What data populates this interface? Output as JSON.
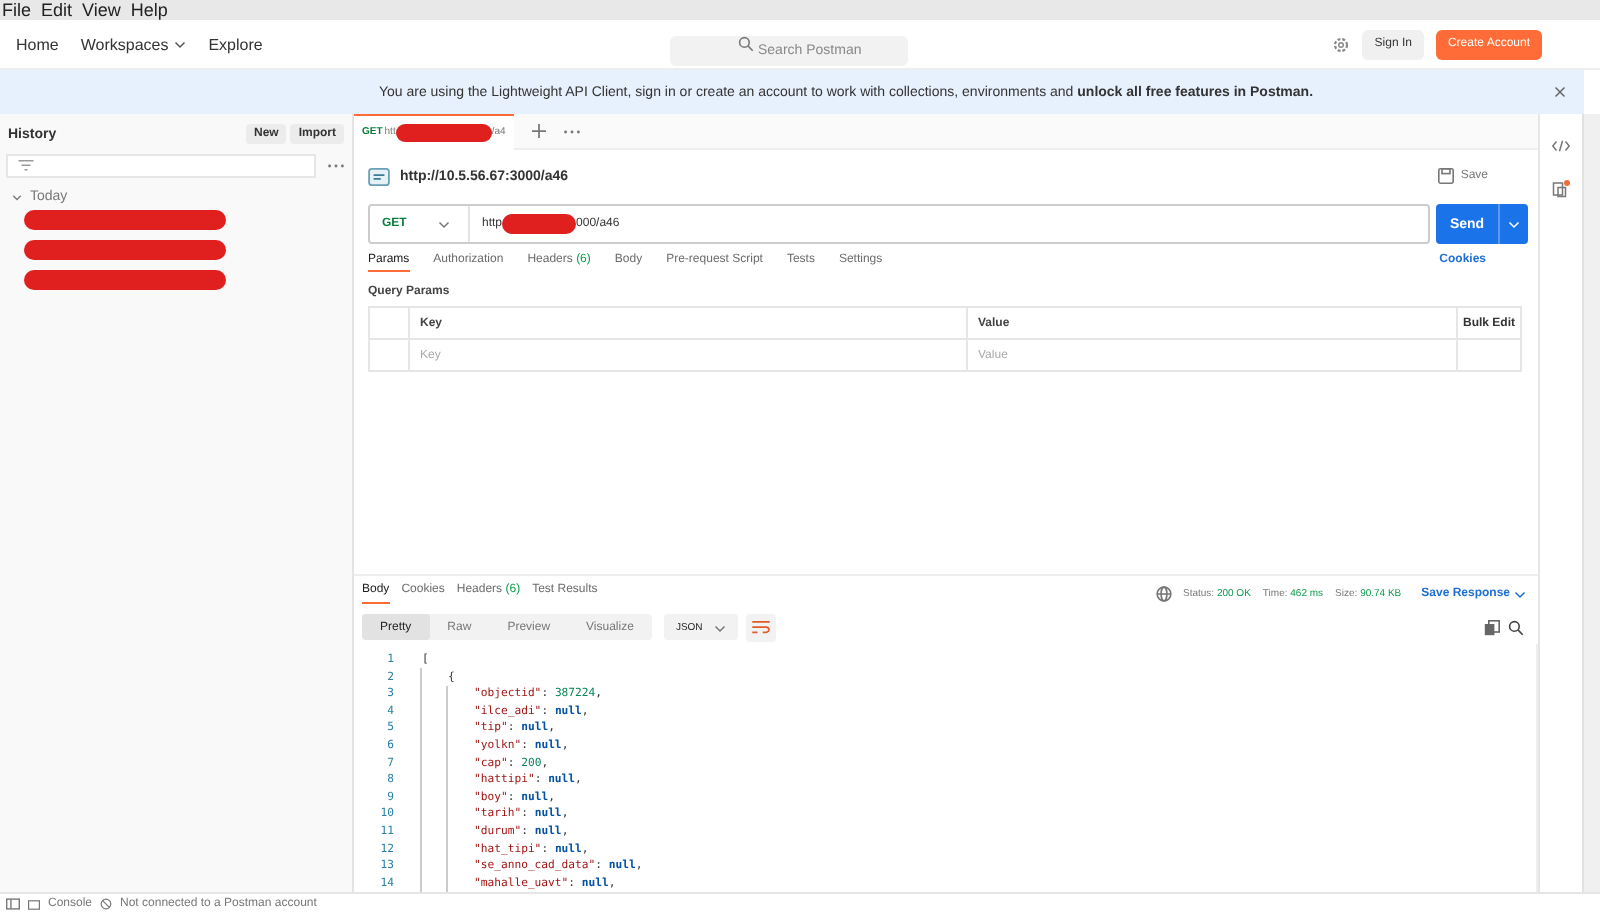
{
  "menu_bar": [
    "File",
    "Edit",
    "View",
    "Help"
  ],
  "header": {
    "nav": [
      {
        "label": "Home",
        "dropdown": false
      },
      {
        "label": "Workspaces",
        "dropdown": true
      },
      {
        "label": "Explore",
        "dropdown": false
      }
    ],
    "search": {
      "placeholder": "Search Postman"
    },
    "buttons": [
      {
        "label": "Sign In",
        "kind": "secondary"
      },
      {
        "label": "Create Account",
        "kind": "primary"
      }
    ]
  },
  "banner": {
    "text": "You are using the Lightweight API Client, sign in or create an account to work with collections, environments and **unlock all free features in Postman.**"
  },
  "sidebar": {
    "title": "History",
    "buttons": [
      "New",
      "Import"
    ],
    "groups": [
      {
        "label": "Today",
        "expanded": true,
        "items": [
          {
            "kind": "redacted"
          },
          {
            "kind": "redacted"
          },
          {
            "kind": "redacted"
          }
        ]
      }
    ]
  },
  "request_tabs": [
    {
      "method": "GET",
      "selected": true,
      "parts": [
        {
          "kind": "text",
          "text": "htt"
        },
        {
          "kind": "redacted"
        },
        {
          "kind": "text",
          "text": "/a4"
        }
      ]
    }
  ],
  "request": {
    "title": "http://10.5.56.67:3000/a46",
    "save_label": "Save",
    "method": "GET",
    "url_parts": [
      {
        "kind": "text",
        "text": "http"
      },
      {
        "kind": "redacted"
      },
      {
        "kind": "text",
        "text": "000/a46"
      }
    ],
    "send_label": "Send",
    "tabs": [
      {
        "label": "Params",
        "selected": true
      },
      {
        "label": "Authorization",
        "selected": false
      },
      {
        "label": "Headers",
        "count": "(6)",
        "selected": false
      },
      {
        "label": "Body",
        "selected": false
      },
      {
        "label": "Pre-request Script",
        "selected": false
      },
      {
        "label": "Tests",
        "selected": false
      },
      {
        "label": "Settings",
        "selected": false
      }
    ],
    "cookies_label": "Cookies",
    "query_params": {
      "title": "Query Params",
      "columns": [
        "Key",
        "Value"
      ],
      "bulk_edit": "Bulk Edit",
      "key_placeholder": "Key",
      "value_placeholder": "Value"
    }
  },
  "response": {
    "tabs": [
      {
        "label": "Body",
        "selected": true
      },
      {
        "label": "Cookies",
        "selected": false
      },
      {
        "label": "Headers",
        "count": "(6)",
        "selected": false
      },
      {
        "label": "Test Results",
        "selected": false
      }
    ],
    "stats": [
      {
        "label": "Status:",
        "value": "200 OK"
      },
      {
        "label": "Time:",
        "value": "462 ms"
      },
      {
        "label": "Size:",
        "value": "90.74 KB"
      }
    ],
    "save_response": "Save Response",
    "view_modes": [
      {
        "label": "Pretty",
        "selected": true
      },
      {
        "label": "Raw",
        "selected": false
      },
      {
        "label": "Preview",
        "selected": false
      },
      {
        "label": "Visualize",
        "selected": false
      }
    ],
    "format": "JSON",
    "lines": [
      {
        "number": "1",
        "parts": [
          {
            "kind": "punct",
            "text": "["
          }
        ],
        "children": [
          {
            "number": "2",
            "parts": [
              {
                "kind": "punct",
                "text": "{"
              }
            ],
            "children": [
              {
                "number": "3",
                "parts": [
                  {
                    "kind": "key",
                    "text": "\"objectid\""
                  },
                  {
                    "kind": "punct",
                    "text": ": "
                  },
                  {
                    "kind": "number",
                    "text": "387224"
                  },
                  {
                    "kind": "punct",
                    "text": ","
                  }
                ]
              },
              {
                "number": "4",
                "parts": [
                  {
                    "kind": "key",
                    "text": "\"ilce_adi\""
                  },
                  {
                    "kind": "punct",
                    "text": ": "
                  },
                  {
                    "kind": "null",
                    "text": "null"
                  },
                  {
                    "kind": "punct",
                    "text": ","
                  }
                ]
              },
              {
                "number": "5",
                "parts": [
                  {
                    "kind": "key",
                    "text": "\"tip\""
                  },
                  {
                    "kind": "punct",
                    "text": ": "
                  },
                  {
                    "kind": "null",
                    "text": "null"
                  },
                  {
                    "kind": "punct",
                    "text": ","
                  }
                ]
              },
              {
                "number": "6",
                "parts": [
                  {
                    "kind": "key",
                    "text": "\"yolkn\""
                  },
                  {
                    "kind": "punct",
                    "text": ": "
                  },
                  {
                    "kind": "null",
                    "text": "null"
                  },
                  {
                    "kind": "punct",
                    "text": ","
                  }
                ]
              },
              {
                "number": "7",
                "parts": [
                  {
                    "kind": "key",
                    "text": "\"cap\""
                  },
                  {
                    "kind": "punct",
                    "text": ": "
                  },
                  {
                    "kind": "number",
                    "text": "200"
                  },
                  {
                    "kind": "punct",
                    "text": ","
                  }
                ]
              },
              {
                "number": "8",
                "parts": [
                  {
                    "kind": "key",
                    "text": "\"hattipi\""
                  },
                  {
                    "kind": "punct",
                    "text": ": "
                  },
                  {
                    "kind": "null",
                    "text": "null"
                  },
                  {
                    "kind": "punct",
                    "text": ","
                  }
                ]
              },
              {
                "number": "9",
                "parts": [
                  {
                    "kind": "key",
                    "text": "\"boy\""
                  },
                  {
                    "kind": "punct",
                    "text": ": "
                  },
                  {
                    "kind": "null",
                    "text": "null"
                  },
                  {
                    "kind": "punct",
                    "text": ","
                  }
                ]
              },
              {
                "number": "10",
                "parts": [
                  {
                    "kind": "key",
                    "text": "\"tarih\""
                  },
                  {
                    "kind": "punct",
                    "text": ": "
                  },
                  {
                    "kind": "null",
                    "text": "null"
                  },
                  {
                    "kind": "punct",
                    "text": ","
                  }
                ]
              },
              {
                "number": "11",
                "parts": [
                  {
                    "kind": "key",
                    "text": "\"durum\""
                  },
                  {
                    "kind": "punct",
                    "text": ": "
                  },
                  {
                    "kind": "null",
                    "text": "null"
                  },
                  {
                    "kind": "punct",
                    "text": ","
                  }
                ]
              },
              {
                "number": "12",
                "parts": [
                  {
                    "kind": "key",
                    "text": "\"hat_tipi\""
                  },
                  {
                    "kind": "punct",
                    "text": ": "
                  },
                  {
                    "kind": "null",
                    "text": "null"
                  },
                  {
                    "kind": "punct",
                    "text": ","
                  }
                ]
              },
              {
                "number": "13",
                "parts": [
                  {
                    "kind": "key",
                    "text": "\"se_anno_cad_data\""
                  },
                  {
                    "kind": "punct",
                    "text": ": "
                  },
                  {
                    "kind": "null",
                    "text": "null"
                  },
                  {
                    "kind": "punct",
                    "text": ","
                  }
                ]
              },
              {
                "number": "14",
                "parts": [
                  {
                    "kind": "key",
                    "text": "\"mahalle_uavt\""
                  },
                  {
                    "kind": "punct",
                    "text": ": "
                  },
                  {
                    "kind": "null",
                    "text": "null"
                  },
                  {
                    "kind": "punct",
                    "text": ","
                  }
                ]
              }
            ]
          }
        ]
      }
    ]
  },
  "status_bar": [
    "Console",
    "Not connected to a Postman account"
  ]
}
